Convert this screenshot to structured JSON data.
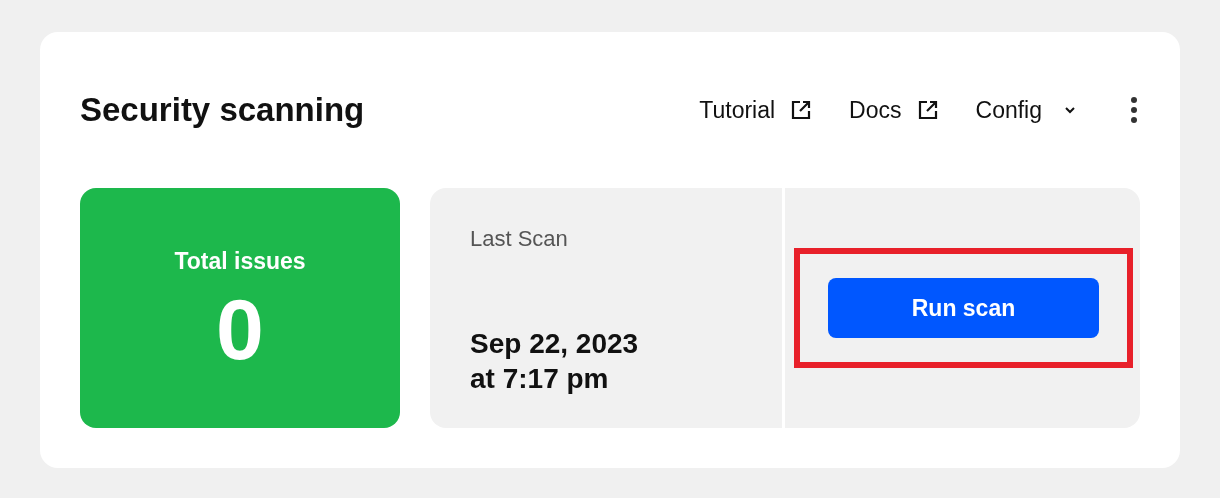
{
  "card": {
    "title": "Security scanning",
    "header_links": [
      {
        "label": "Tutorial",
        "kind": "external"
      },
      {
        "label": "Docs",
        "kind": "external"
      },
      {
        "label": "Config",
        "kind": "dropdown"
      }
    ],
    "total_issues": {
      "label": "Total issues",
      "value": "0",
      "color": "#1db84c"
    },
    "last_scan": {
      "label": "Last Scan",
      "date": "Sep 22, 2023",
      "time": "at 7:17 pm"
    },
    "run_button": {
      "label": "Run scan",
      "highlighted": true
    }
  }
}
